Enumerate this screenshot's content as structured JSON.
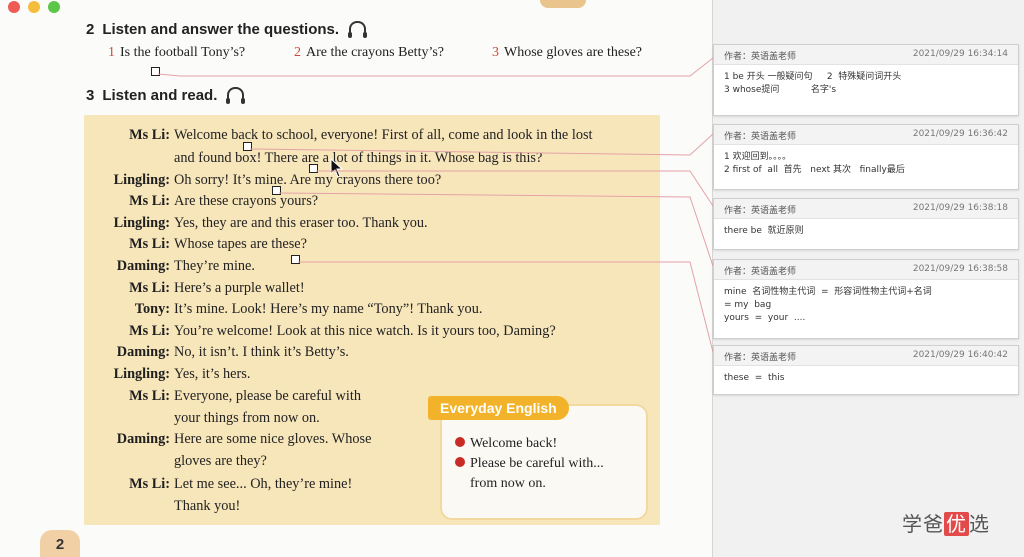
{
  "textbook": {
    "section2_title": "Listen and answer the questions.",
    "section2_num": "2",
    "questions": [
      {
        "num": "1",
        "text": "Is the football Tony’s?"
      },
      {
        "num": "2",
        "text": "Are the crayons Betty’s?"
      },
      {
        "num": "3",
        "text": "Whose gloves are these?"
      }
    ],
    "section3_title": "Listen and read.",
    "section3_num": "3",
    "dialogue": [
      {
        "speaker": "Ms Li:",
        "lines": [
          "Welcome back to school, everyone! First of all, come and look in the lost",
          "and found box! There are a lot of things in it. Whose bag is this?"
        ]
      },
      {
        "speaker": "Lingling:",
        "lines": [
          "Oh sorry! It’s mine. Are my crayons there too?"
        ]
      },
      {
        "speaker": "Ms Li:",
        "lines": [
          "Are these crayons yours?"
        ]
      },
      {
        "speaker": "Lingling:",
        "lines": [
          "Yes, they are and this eraser too. Thank you."
        ]
      },
      {
        "speaker": "Ms Li:",
        "lines": [
          "Whose tapes are these?"
        ]
      },
      {
        "speaker": "Daming:",
        "lines": [
          "They’re mine."
        ]
      },
      {
        "speaker": "Ms Li:",
        "lines": [
          "Here’s a purple wallet!"
        ]
      },
      {
        "speaker": "Tony:",
        "lines": [
          "It’s mine. Look! Here’s my name “Tony”! Thank you."
        ]
      },
      {
        "speaker": "Ms Li:",
        "lines": [
          "You’re welcome! Look at this nice watch. Is it yours too, Daming?"
        ]
      },
      {
        "speaker": "Daming:",
        "lines": [
          "No, it isn’t. I think it’s Betty’s."
        ]
      },
      {
        "speaker": "Lingling:",
        "lines": [
          "Yes, it’s hers."
        ]
      },
      {
        "speaker": "Ms Li:",
        "lines": [
          "Everyone, please be careful with",
          "your things from now on."
        ]
      },
      {
        "speaker": "Daming:",
        "lines": [
          "Here are some nice gloves. Whose",
          "gloves are they?"
        ]
      },
      {
        "speaker": "Ms Li:",
        "lines": [
          "Let me see... Oh, they’re mine!",
          "Thank you!"
        ]
      }
    ],
    "everyday_english": {
      "title": "Everyday English",
      "items": [
        "Welcome back!",
        "Please be careful with...",
        "from now on."
      ]
    },
    "page_number": "2"
  },
  "annotations": [
    {
      "author": "作者：英语盖老师",
      "time": "2021/09/29 16:34:14",
      "lines": [
        "1 be 开头 一般疑问句     2  特殊疑问词开头",
        "3 whose提问           名字's"
      ]
    },
    {
      "author": "作者：英语盖老师",
      "time": "2021/09/29 16:36:42",
      "lines": [
        "1 欢迎回到。。。。",
        "2 first of  all  首先   next 其次   finally最后"
      ]
    },
    {
      "author": "作者：英语盖老师",
      "time": "2021/09/29 16:38:18",
      "lines": [
        "there be  就近原则"
      ]
    },
    {
      "author": "作者：英语盖老师",
      "time": "2021/09/29 16:38:58",
      "lines": [
        "mine  名词性物主代词  =  形容词性物主代词+名词",
        "= my  bag",
        "yours  =  your  ...."
      ]
    },
    {
      "author": "作者：英语盖老师",
      "time": "2021/09/29 16:40:42",
      "lines": [
        "these  =  this"
      ]
    }
  ],
  "watermark": {
    "pre": "学爸",
    "highlight": "优",
    "post": "选"
  }
}
